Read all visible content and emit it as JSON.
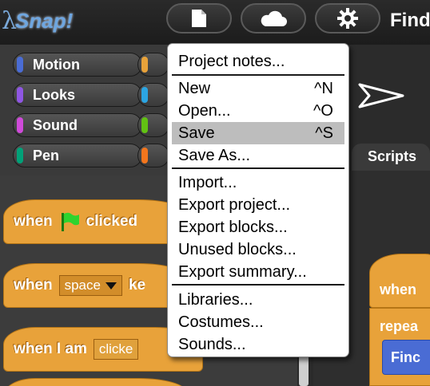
{
  "app": {
    "logo_lambda": "λ",
    "logo_text": "Snap!",
    "project_title": "Find"
  },
  "categories": [
    {
      "label": "Motion",
      "color": "#4a6cd4"
    },
    {
      "label": "Looks",
      "color": "#8f56e3"
    },
    {
      "label": "Sound",
      "color": "#cf4ad9"
    },
    {
      "label": "Pen",
      "color": "#00a178"
    }
  ],
  "palette": {
    "when_flag": {
      "when": "when",
      "clicked": "clicked"
    },
    "when_key": {
      "when": "when",
      "key_value": "space",
      "suffix": "ke"
    },
    "when_i_am": {
      "when": "when I am",
      "value": "clicke"
    }
  },
  "scripts": {
    "tab_label": "Scripts",
    "hat_label": "when",
    "repeat_label": "repea",
    "find_label": "Finc"
  },
  "file_menu": {
    "groups": [
      [
        {
          "label": "Project notes...",
          "shortcut": ""
        }
      ],
      [
        {
          "label": "New",
          "shortcut": "^N"
        },
        {
          "label": "Open...",
          "shortcut": "^O"
        },
        {
          "label": "Save",
          "shortcut": "^S",
          "highlighted": true
        },
        {
          "label": "Save As...",
          "shortcut": ""
        }
      ],
      [
        {
          "label": "Import...",
          "shortcut": ""
        },
        {
          "label": "Export project...",
          "shortcut": ""
        },
        {
          "label": "Export blocks...",
          "shortcut": ""
        },
        {
          "label": "Unused blocks...",
          "shortcut": ""
        },
        {
          "label": "Export summary...",
          "shortcut": ""
        }
      ],
      [
        {
          "label": "Libraries...",
          "shortcut": ""
        },
        {
          "label": "Costumes...",
          "shortcut": ""
        },
        {
          "label": "Sounds...",
          "shortcut": ""
        }
      ]
    ]
  },
  "colors": {
    "control_block": "#e8a23a",
    "motion_block": "#4a6cd4",
    "menu_highlight": "#bdbdbd"
  },
  "icons": {
    "file_button": "file-icon",
    "cloud_button": "cloud-icon",
    "settings_button": "gear-icon",
    "green_flag": "green-flag-icon",
    "sprite": "sprite-arrow-icon"
  }
}
